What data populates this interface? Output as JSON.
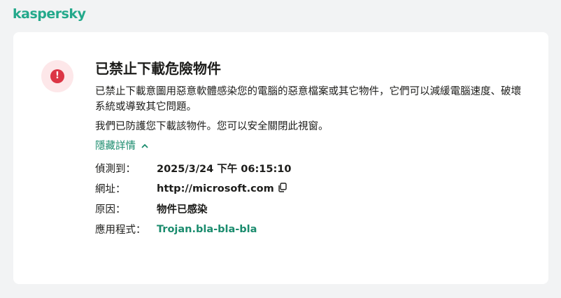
{
  "brand": {
    "logo_text": "kaspersky",
    "accent_color": "#23a98b",
    "alert_color": "#dc3545"
  },
  "alert": {
    "icon": "exclamation-icon",
    "title": "已禁止下載危險物件",
    "description": "已禁止下載意圖用惡意軟體感染您的電腦的惡意檔案或其它物件，它們可以減緩電腦速度、破壞系統或導致其它問題。",
    "protection_note": "我們已防護您下載該物件。您可以安全關閉此視窗。",
    "toggle_label": "隱藏詳情",
    "details": [
      {
        "label": "偵測到：",
        "value": "2025/3/24 下午 06:15:10"
      },
      {
        "label": "網址：",
        "value": "http://microsoft.com"
      },
      {
        "label": "原因：",
        "value": "物件已感染"
      },
      {
        "label": "應用程式：",
        "value": "Trojan.bla-bla-bla"
      }
    ]
  }
}
